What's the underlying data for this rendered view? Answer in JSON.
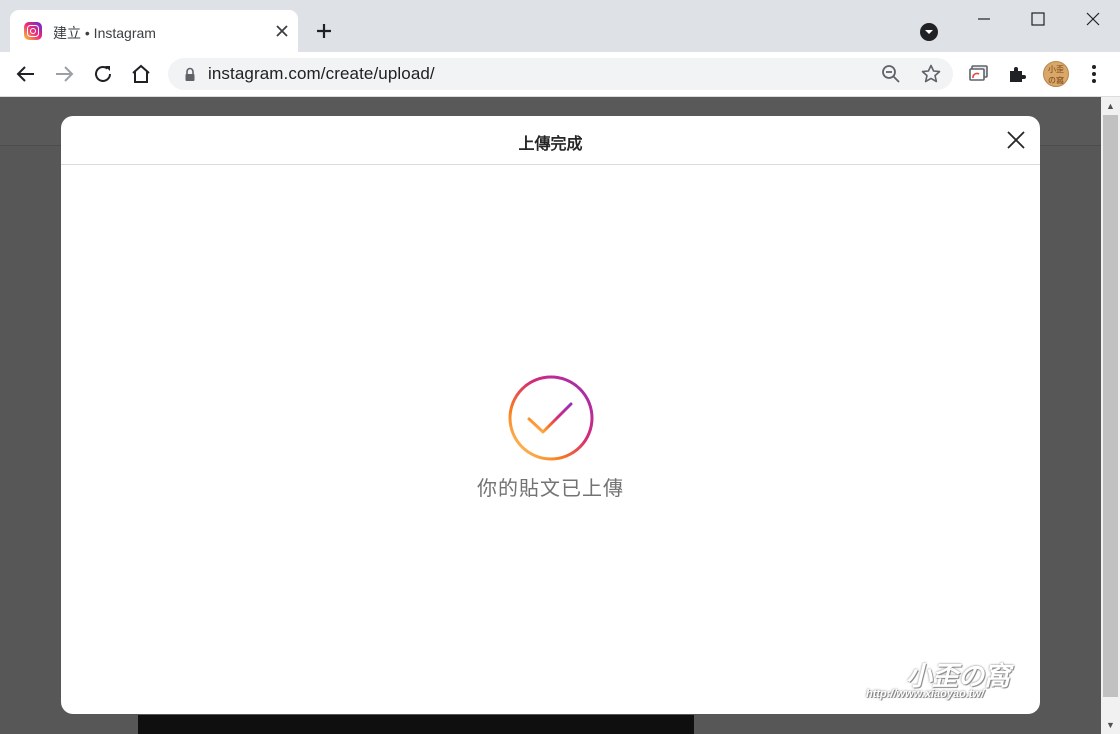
{
  "browser": {
    "tab_title": "建立 • Instagram",
    "url": "instagram.com/create/upload/",
    "avatar_text": "小歪の窩",
    "icons": [
      "instagram-favicon",
      "close-icon",
      "plus-icon",
      "tab-search-icon",
      "minimize-icon",
      "maximize-icon",
      "window-close-icon",
      "back-icon",
      "forward-icon",
      "reload-icon",
      "home-icon",
      "lock-icon",
      "zoom-icon",
      "star-icon",
      "cast-icon",
      "extensions-icon",
      "menu-icon"
    ]
  },
  "modal": {
    "title": "上傳完成",
    "message": "你的貼文已上傳",
    "check_gradient": [
      "#feda75",
      "#fa7e1e",
      "#d62976",
      "#962fbf",
      "#4f5bd5"
    ]
  },
  "watermark": {
    "brand": "小歪の窩",
    "url": "http://www.xiaoyao.tw/"
  }
}
